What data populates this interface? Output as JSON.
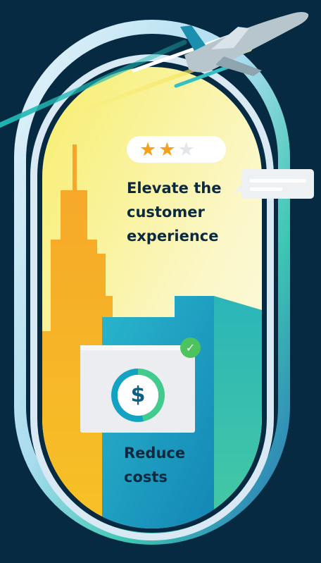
{
  "rating": {
    "stars_filled": 2,
    "stars_total": 3,
    "star_on_color": "#f5a11c",
    "star_off_color": "#e4e7ea"
  },
  "headline": {
    "line1": "Elevate the",
    "line2": "customer",
    "line3": "experience"
  },
  "savings_card": {
    "currency_symbol": "$",
    "check_mark": "✓"
  },
  "caption": {
    "line1": "Reduce",
    "line2": "costs"
  },
  "icons": [
    "airplane-icon",
    "star-icon",
    "chat-bubble-icon",
    "dollar-icon",
    "check-circle-icon"
  ],
  "colors": {
    "background": "#062a42",
    "sky_top": "#fbf27a",
    "building_orange": "#f5a623",
    "building_teal": "#1fa6c4",
    "ring_green": "#4cc98a",
    "ring_blue": "#cfe8f7"
  }
}
